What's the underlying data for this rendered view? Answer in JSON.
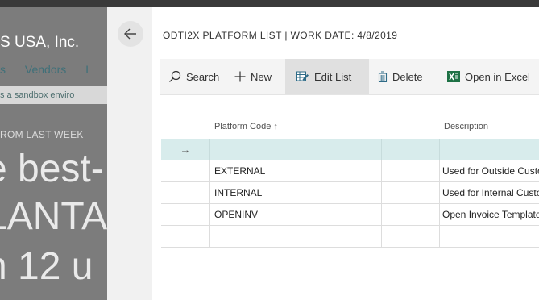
{
  "background": {
    "company_name": "S USA, Inc.",
    "nav_items": [
      "s",
      "Vendors",
      "I"
    ],
    "banner_text": "s a sandbox enviro",
    "caption": "ROM LAST WEEK",
    "big_lines": [
      "e best-",
      "LANTA",
      "n 12 u"
    ]
  },
  "page": {
    "title": "ODTI2X PLATFORM LIST | WORK DATE: 4/8/2019"
  },
  "actions": {
    "search": "Search",
    "new": "New",
    "edit_list": "Edit List",
    "delete": "Delete",
    "open_in_excel": "Open in Excel"
  },
  "table": {
    "columns": {
      "platform_code": "Platform Code ↑",
      "description": "Description"
    },
    "rows": [
      {
        "platform_code": "",
        "extra": "",
        "description": ""
      },
      {
        "platform_code": "EXTERNAL",
        "extra": "",
        "description": "Used for Outside Customers"
      },
      {
        "platform_code": "INTERNAL",
        "extra": "",
        "description": "Used for Internal Customers"
      },
      {
        "platform_code": "OPENINV",
        "extra": "",
        "description": "Open Invoice Template"
      },
      {
        "platform_code": "",
        "extra": "",
        "description": ""
      }
    ],
    "row_arrow": "→"
  },
  "colors": {
    "accent": "#3f7079",
    "selected_row": "#d8ecec",
    "excel_green": "#1e7145",
    "edit_icon": "#2e6b87"
  }
}
